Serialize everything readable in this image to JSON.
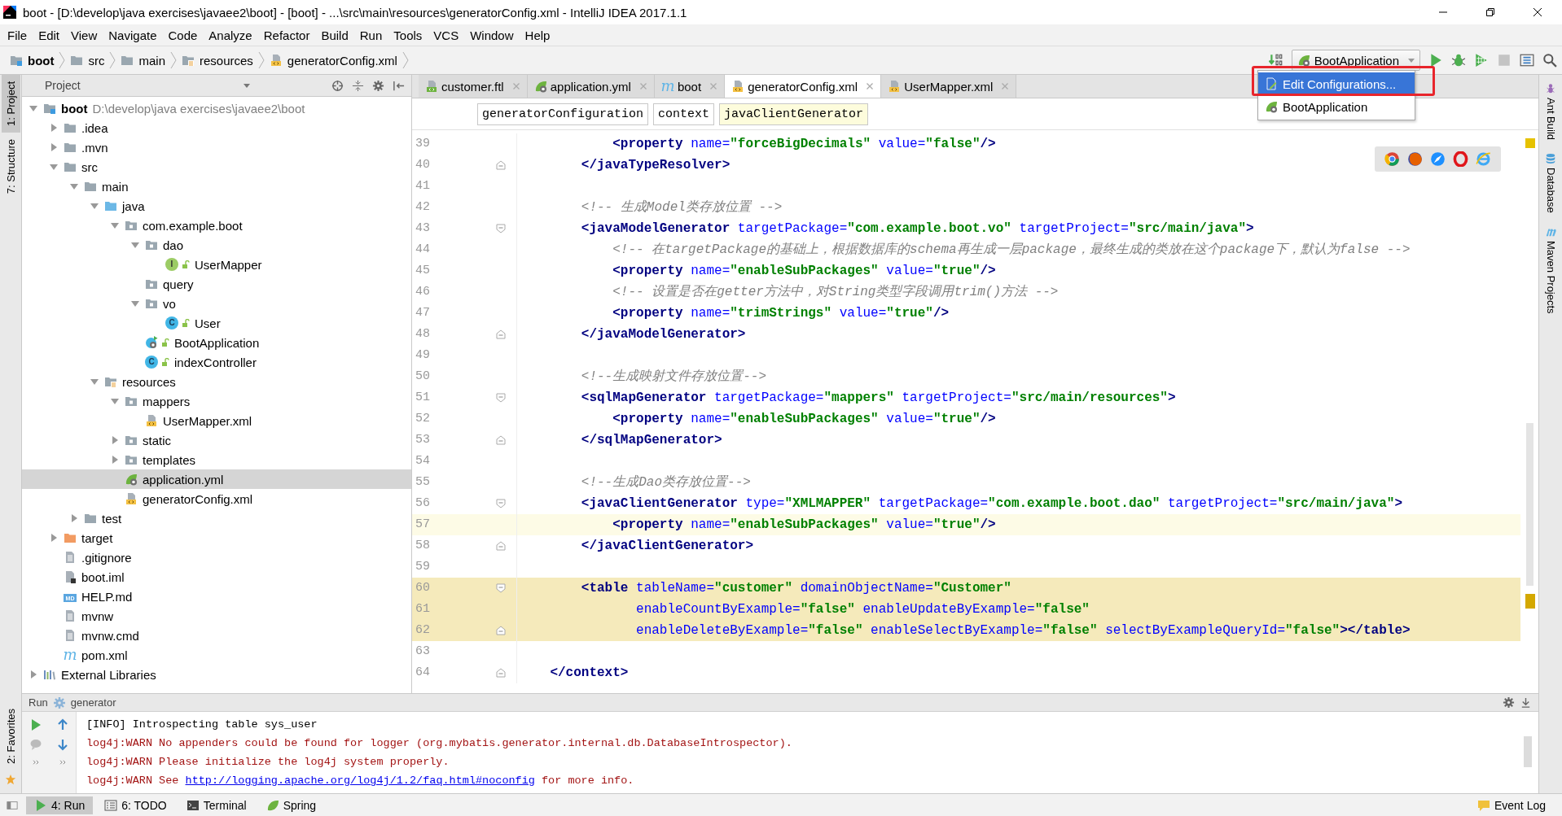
{
  "window": {
    "title": "boot - [D:\\develop\\java exercises\\javaee2\\boot] - [boot] - ...\\src\\main\\resources\\generatorConfig.xml - IntelliJ IDEA 2017.1.1"
  },
  "menu": [
    "File",
    "Edit",
    "View",
    "Navigate",
    "Code",
    "Analyze",
    "Refactor",
    "Build",
    "Run",
    "Tools",
    "VCS",
    "Window",
    "Help"
  ],
  "navigation_bar": [
    {
      "label": "boot",
      "kind": "module"
    },
    {
      "label": "src",
      "kind": "folder"
    },
    {
      "label": "main",
      "kind": "folder"
    },
    {
      "label": "resources",
      "kind": "resources"
    },
    {
      "label": "generatorConfig.xml",
      "kind": "xml"
    }
  ],
  "toolbar": {
    "run_configuration": "BootApplication"
  },
  "run_menu": [
    {
      "label": "Edit Configurations...",
      "kind": "edit",
      "selected": true
    },
    {
      "label": "BootApplication",
      "kind": "spring",
      "selected": false
    }
  ],
  "left_tool_strip": [
    {
      "label": "1: Project",
      "selected": true
    },
    {
      "label": "7: Structure",
      "selected": false
    }
  ],
  "favorites_tab": {
    "label": "2: Favorites"
  },
  "right_tool_strip": [
    {
      "label": "Ant Build",
      "kind": "ant"
    },
    {
      "label": "Database",
      "kind": "database"
    },
    {
      "label": "Maven Projects",
      "kind": "maven"
    }
  ],
  "project_panel": {
    "title": "Project",
    "tree": [
      {
        "label": "boot",
        "detail": "D:\\develop\\java exercises\\javaee2\\boot",
        "kind": "module",
        "expanded": true,
        "selected": false,
        "children": [
          {
            "label": ".idea",
            "kind": "folder",
            "expanded": false,
            "selected": false
          },
          {
            "label": ".mvn",
            "kind": "folder",
            "expanded": false,
            "selected": false
          },
          {
            "label": "src",
            "kind": "folder",
            "expanded": true,
            "selected": false,
            "children": [
              {
                "label": "main",
                "kind": "folder",
                "expanded": true,
                "selected": false,
                "children": [
                  {
                    "label": "java",
                    "kind": "sources",
                    "expanded": true,
                    "selected": false,
                    "children": [
                      {
                        "label": "com.example.boot",
                        "kind": "package",
                        "expanded": true,
                        "selected": false,
                        "children": [
                          {
                            "label": "dao",
                            "kind": "package",
                            "expanded": true,
                            "selected": false,
                            "children": [
                              {
                                "label": "UserMapper",
                                "kind": "interface",
                                "icon_text": "I",
                                "selected": false
                              }
                            ]
                          },
                          {
                            "label": "query",
                            "kind": "package",
                            "selected": false
                          },
                          {
                            "label": "vo",
                            "kind": "package",
                            "expanded": true,
                            "selected": false,
                            "children": [
                              {
                                "label": "User",
                                "kind": "class",
                                "icon_text": "C",
                                "selected": false
                              }
                            ]
                          },
                          {
                            "label": "BootApplication",
                            "kind": "application",
                            "selected": false
                          },
                          {
                            "label": "indexController",
                            "kind": "class",
                            "icon_text": "C",
                            "selected": false
                          }
                        ]
                      }
                    ]
                  },
                  {
                    "label": "resources",
                    "kind": "resources",
                    "expanded": true,
                    "selected": false,
                    "children": [
                      {
                        "label": "mappers",
                        "kind": "package",
                        "expanded": true,
                        "selected": false,
                        "children": [
                          {
                            "label": "UserMapper.xml",
                            "kind": "xml",
                            "selected": false
                          }
                        ]
                      },
                      {
                        "label": "static",
                        "kind": "package",
                        "expanded": false,
                        "selected": false
                      },
                      {
                        "label": "templates",
                        "kind": "package",
                        "expanded": false,
                        "selected": false
                      },
                      {
                        "label": "application.yml",
                        "kind": "spring",
                        "selected": true
                      },
                      {
                        "label": "generatorConfig.xml",
                        "kind": "xml",
                        "selected": false
                      }
                    ]
                  }
                ]
              },
              {
                "label": "test",
                "kind": "folder",
                "expanded": false,
                "selected": false
              }
            ]
          },
          {
            "label": "target",
            "kind": "excluded",
            "expanded": false,
            "selected": false
          },
          {
            "label": ".gitignore",
            "kind": "text",
            "selected": false
          },
          {
            "label": "boot.iml",
            "kind": "iml",
            "selected": false
          },
          {
            "label": "HELP.md",
            "kind": "markdown",
            "icon_text": "MD",
            "selected": false
          },
          {
            "label": "mvnw",
            "kind": "text",
            "selected": false
          },
          {
            "label": "mvnw.cmd",
            "kind": "text",
            "selected": false
          },
          {
            "label": "pom.xml",
            "kind": "maven",
            "icon_text": "m",
            "selected": false
          }
        ]
      },
      {
        "label": "External Libraries",
        "kind": "libraries",
        "expanded": false,
        "selected": false
      }
    ]
  },
  "editor": {
    "tabs": [
      {
        "label": "customer.ftl",
        "kind": "template",
        "selected": false
      },
      {
        "label": "application.yml",
        "kind": "spring",
        "selected": false
      },
      {
        "label": "boot",
        "kind": "maven",
        "icon_text": "m",
        "selected": false
      },
      {
        "label": "generatorConfig.xml",
        "kind": "xml",
        "selected": true
      },
      {
        "label": "UserMapper.xml",
        "kind": "xml",
        "selected": false
      }
    ],
    "breadcrumbs": [
      {
        "label": "generatorConfiguration",
        "selected": false
      },
      {
        "label": "context",
        "selected": false
      },
      {
        "label": "javaClientGenerator",
        "selected": true
      }
    ],
    "lines": [
      {
        "number": "39",
        "kind": "plain",
        "current": false,
        "highlighted": false,
        "segments": [
          {
            "kind": "tag",
            "text": "            <property"
          },
          {
            "kind": "attribute",
            "text": " name="
          },
          {
            "kind": "value",
            "text": "\"forceBigDecimals\""
          },
          {
            "kind": "attribute",
            "text": " value="
          },
          {
            "kind": "value",
            "text": "\"false\""
          },
          {
            "kind": "tag",
            "text": "/>"
          }
        ]
      },
      {
        "number": "40",
        "kind": "closer",
        "current": false,
        "highlighted": false,
        "segments": [
          {
            "kind": "tag",
            "text": "        </javaTypeResolver>"
          }
        ]
      },
      {
        "number": "41",
        "kind": "plain",
        "current": false,
        "highlighted": false
      },
      {
        "number": "42",
        "kind": "plain",
        "current": false,
        "highlighted": false,
        "segments": [
          {
            "kind": "comment",
            "text": "        <!-- 生成Model类存放位置 -->"
          }
        ]
      },
      {
        "number": "43",
        "kind": "opener",
        "current": false,
        "highlighted": false,
        "segments": [
          {
            "kind": "tag",
            "text": "        <javaModelGenerator"
          },
          {
            "kind": "attribute",
            "text": " targetPackage="
          },
          {
            "kind": "value",
            "text": "\"com.example.boot.vo\""
          },
          {
            "kind": "attribute",
            "text": " targetProject="
          },
          {
            "kind": "value",
            "text": "\"src/main/java\""
          },
          {
            "kind": "tag",
            "text": ">"
          }
        ]
      },
      {
        "number": "44",
        "kind": "plain",
        "current": false,
        "highlighted": false,
        "segments": [
          {
            "kind": "comment",
            "text": "            <!-- 在targetPackage的基础上，根据数据库的schema再生成一层package，最终生成的类放在这个package下，默认为false -->"
          }
        ]
      },
      {
        "number": "45",
        "kind": "plain",
        "current": false,
        "highlighted": false,
        "segments": [
          {
            "kind": "tag",
            "text": "            <property"
          },
          {
            "kind": "attribute",
            "text": " name="
          },
          {
            "kind": "value",
            "text": "\"enableSubPackages\""
          },
          {
            "kind": "attribute",
            "text": " value="
          },
          {
            "kind": "value",
            "text": "\"true\""
          },
          {
            "kind": "tag",
            "text": "/>"
          }
        ]
      },
      {
        "number": "46",
        "kind": "plain",
        "current": false,
        "highlighted": false,
        "segments": [
          {
            "kind": "comment",
            "text": "            <!-- 设置是否在getter方法中，对String类型字段调用trim()方法 -->"
          }
        ]
      },
      {
        "number": "47",
        "kind": "plain",
        "current": false,
        "highlighted": false,
        "segments": [
          {
            "kind": "tag",
            "text": "            <property"
          },
          {
            "kind": "attribute",
            "text": " name="
          },
          {
            "kind": "value",
            "text": "\"trimStrings\""
          },
          {
            "kind": "attribute",
            "text": " value="
          },
          {
            "kind": "value",
            "text": "\"true\""
          },
          {
            "kind": "tag",
            "text": "/>"
          }
        ]
      },
      {
        "number": "48",
        "kind": "closer",
        "current": false,
        "highlighted": false,
        "segments": [
          {
            "kind": "tag",
            "text": "        </javaModelGenerator>"
          }
        ]
      },
      {
        "number": "49",
        "kind": "plain",
        "current": false,
        "highlighted": false
      },
      {
        "number": "50",
        "kind": "plain",
        "current": false,
        "highlighted": false,
        "segments": [
          {
            "kind": "comment",
            "text": "        <!--生成映射文件存放位置-->"
          }
        ]
      },
      {
        "number": "51",
        "kind": "opener",
        "current": false,
        "highlighted": false,
        "segments": [
          {
            "kind": "tag",
            "text": "        <sqlMapGenerator"
          },
          {
            "kind": "attribute",
            "text": " targetPackage="
          },
          {
            "kind": "value",
            "text": "\"mappers\""
          },
          {
            "kind": "attribute",
            "text": " targetProject="
          },
          {
            "kind": "value",
            "text": "\"src/main/resources\""
          },
          {
            "kind": "tag",
            "text": ">"
          }
        ]
      },
      {
        "number": "52",
        "kind": "plain",
        "current": false,
        "highlighted": false,
        "segments": [
          {
            "kind": "tag",
            "text": "            <property"
          },
          {
            "kind": "attribute",
            "text": " name="
          },
          {
            "kind": "value",
            "text": "\"enableSubPackages\""
          },
          {
            "kind": "attribute",
            "text": " value="
          },
          {
            "kind": "value",
            "text": "\"true\""
          },
          {
            "kind": "tag",
            "text": "/>"
          }
        ]
      },
      {
        "number": "53",
        "kind": "closer",
        "current": false,
        "highlighted": false,
        "segments": [
          {
            "kind": "tag",
            "text": "        </sqlMapGenerator>"
          }
        ]
      },
      {
        "number": "54",
        "kind": "plain",
        "current": false,
        "highlighted": false
      },
      {
        "number": "55",
        "kind": "plain",
        "current": false,
        "highlighted": false,
        "segments": [
          {
            "kind": "comment",
            "text": "        <!--生成Dao类存放位置-->"
          }
        ]
      },
      {
        "number": "56",
        "kind": "opener",
        "current": false,
        "highlighted": false,
        "segments": [
          {
            "kind": "tag",
            "text": "        <javaClientGenerator"
          },
          {
            "kind": "attribute",
            "text": " type="
          },
          {
            "kind": "value",
            "text": "\"XMLMAPPER\""
          },
          {
            "kind": "attribute",
            "text": " targetPackage="
          },
          {
            "kind": "value",
            "text": "\"com.example.boot.dao\""
          },
          {
            "kind": "attribute",
            "text": " targetProject="
          },
          {
            "kind": "value",
            "text": "\"src/main/java\""
          },
          {
            "kind": "tag",
            "text": ">"
          }
        ]
      },
      {
        "number": "57",
        "kind": "plain",
        "current": true,
        "highlighted": false,
        "segments": [
          {
            "kind": "tag",
            "text": "            <property"
          },
          {
            "kind": "attribute",
            "text": " name="
          },
          {
            "kind": "value",
            "text": "\"enableSubPackages\""
          },
          {
            "kind": "attribute",
            "text": " value="
          },
          {
            "kind": "value",
            "text": "\"true\""
          },
          {
            "kind": "tag",
            "text": "/>"
          }
        ]
      },
      {
        "number": "58",
        "kind": "closer",
        "current": false,
        "highlighted": false,
        "segments": [
          {
            "kind": "tag",
            "text": "        </javaClientGenerator>"
          }
        ]
      },
      {
        "number": "59",
        "kind": "plain",
        "current": false,
        "highlighted": false
      },
      {
        "number": "60",
        "kind": "opener",
        "current": false,
        "highlighted": true,
        "segments": [
          {
            "kind": "tag",
            "text": "        <table"
          },
          {
            "kind": "attribute",
            "text": " tableName="
          },
          {
            "kind": "value",
            "text": "\"customer\""
          },
          {
            "kind": "attribute",
            "text": " domainObjectName="
          },
          {
            "kind": "value",
            "text": "\"Customer\""
          }
        ]
      },
      {
        "number": "61",
        "kind": "plain",
        "current": false,
        "highlighted": true,
        "segments": [
          {
            "kind": "attribute",
            "text": "               enableCountByExample="
          },
          {
            "kind": "value",
            "text": "\"false\""
          },
          {
            "kind": "attribute",
            "text": " enableUpdateByExample="
          },
          {
            "kind": "value",
            "text": "\"false\""
          }
        ]
      },
      {
        "number": "62",
        "kind": "closer",
        "current": false,
        "highlighted": true,
        "segments": [
          {
            "kind": "attribute",
            "text": "               enableDeleteByExample="
          },
          {
            "kind": "value",
            "text": "\"false\""
          },
          {
            "kind": "attribute",
            "text": " enableSelectByExample="
          },
          {
            "kind": "value",
            "text": "\"false\""
          },
          {
            "kind": "attribute",
            "text": " selectByExampleQueryId="
          },
          {
            "kind": "value",
            "text": "\"false\""
          },
          {
            "kind": "tag",
            "text": "></table>"
          }
        ]
      },
      {
        "number": "63",
        "kind": "plain",
        "current": false,
        "highlighted": false
      },
      {
        "number": "64",
        "kind": "closer",
        "current": false,
        "highlighted": false,
        "segments": [
          {
            "kind": "tag",
            "text": "    </context>"
          }
        ]
      }
    ]
  },
  "run_panel": {
    "title": "Run",
    "configuration": "generator",
    "console": [
      {
        "kind": "info",
        "text": "[INFO] Introspecting table sys_user"
      },
      {
        "kind": "warn",
        "text": "log4j:WARN No appenders could be found for logger (org.mybatis.generator.internal.db.DatabaseIntrospector)."
      },
      {
        "kind": "warn",
        "text": "log4j:WARN Please initialize the log4j system properly."
      },
      {
        "kind": "warn",
        "text": "log4j:WARN See ",
        "link": "http://logging.apache.org/log4j/1.2/faq.html#noconfig",
        "text_after": " for more info."
      }
    ]
  },
  "bottom_tools": [
    {
      "label": "4: Run",
      "kind": "run",
      "selected": true
    },
    {
      "label": "6: TODO",
      "kind": "todo",
      "selected": false
    },
    {
      "label": "Terminal",
      "kind": "terminal",
      "selected": false
    },
    {
      "label": "Spring",
      "kind": "spring",
      "selected": false
    }
  ],
  "event_log": {
    "label": "Event Log"
  }
}
